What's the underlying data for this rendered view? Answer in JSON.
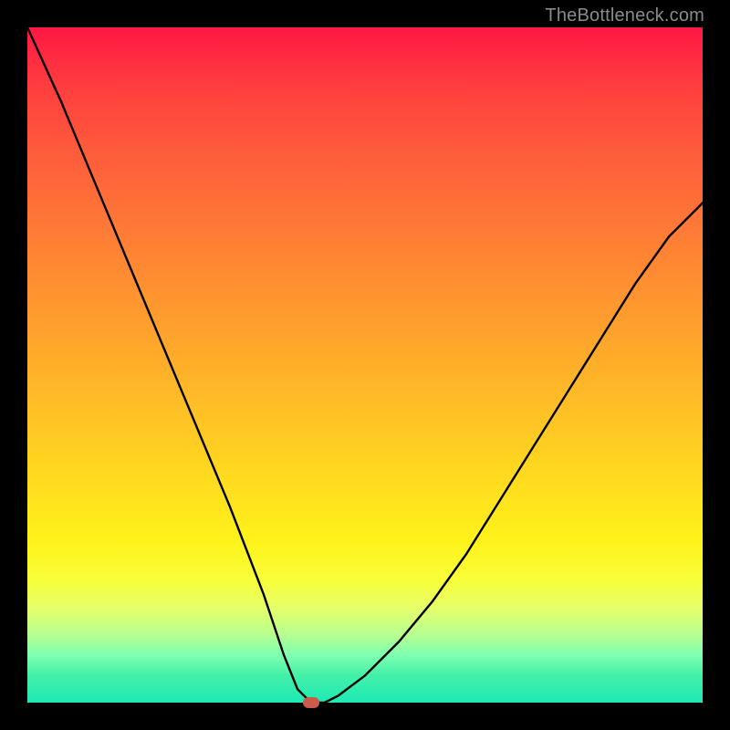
{
  "watermark": "TheBottleneck.com",
  "colors": {
    "frame": "#000000",
    "curve": "#000000",
    "marker": "#cc5a4a",
    "watermark": "#8a8a8a"
  },
  "chart_data": {
    "type": "line",
    "title": "",
    "xlabel": "",
    "ylabel": "",
    "xlim": [
      0,
      100
    ],
    "ylim": [
      0,
      100
    ],
    "grid": false,
    "annotations": [
      {
        "label": "optimum-marker",
        "x": 42,
        "y": 0
      }
    ],
    "series": [
      {
        "name": "bottleneck-curve",
        "x": [
          0,
          5,
          10,
          15,
          20,
          25,
          30,
          35,
          38,
          40,
          42,
          44,
          46,
          50,
          55,
          60,
          65,
          70,
          75,
          80,
          85,
          90,
          95,
          100
        ],
        "y": [
          100,
          89,
          77,
          65,
          53,
          41,
          29,
          16,
          7,
          2,
          0,
          0,
          1,
          4,
          9,
          15,
          22,
          30,
          38,
          46,
          54,
          62,
          69,
          74
        ]
      }
    ]
  }
}
